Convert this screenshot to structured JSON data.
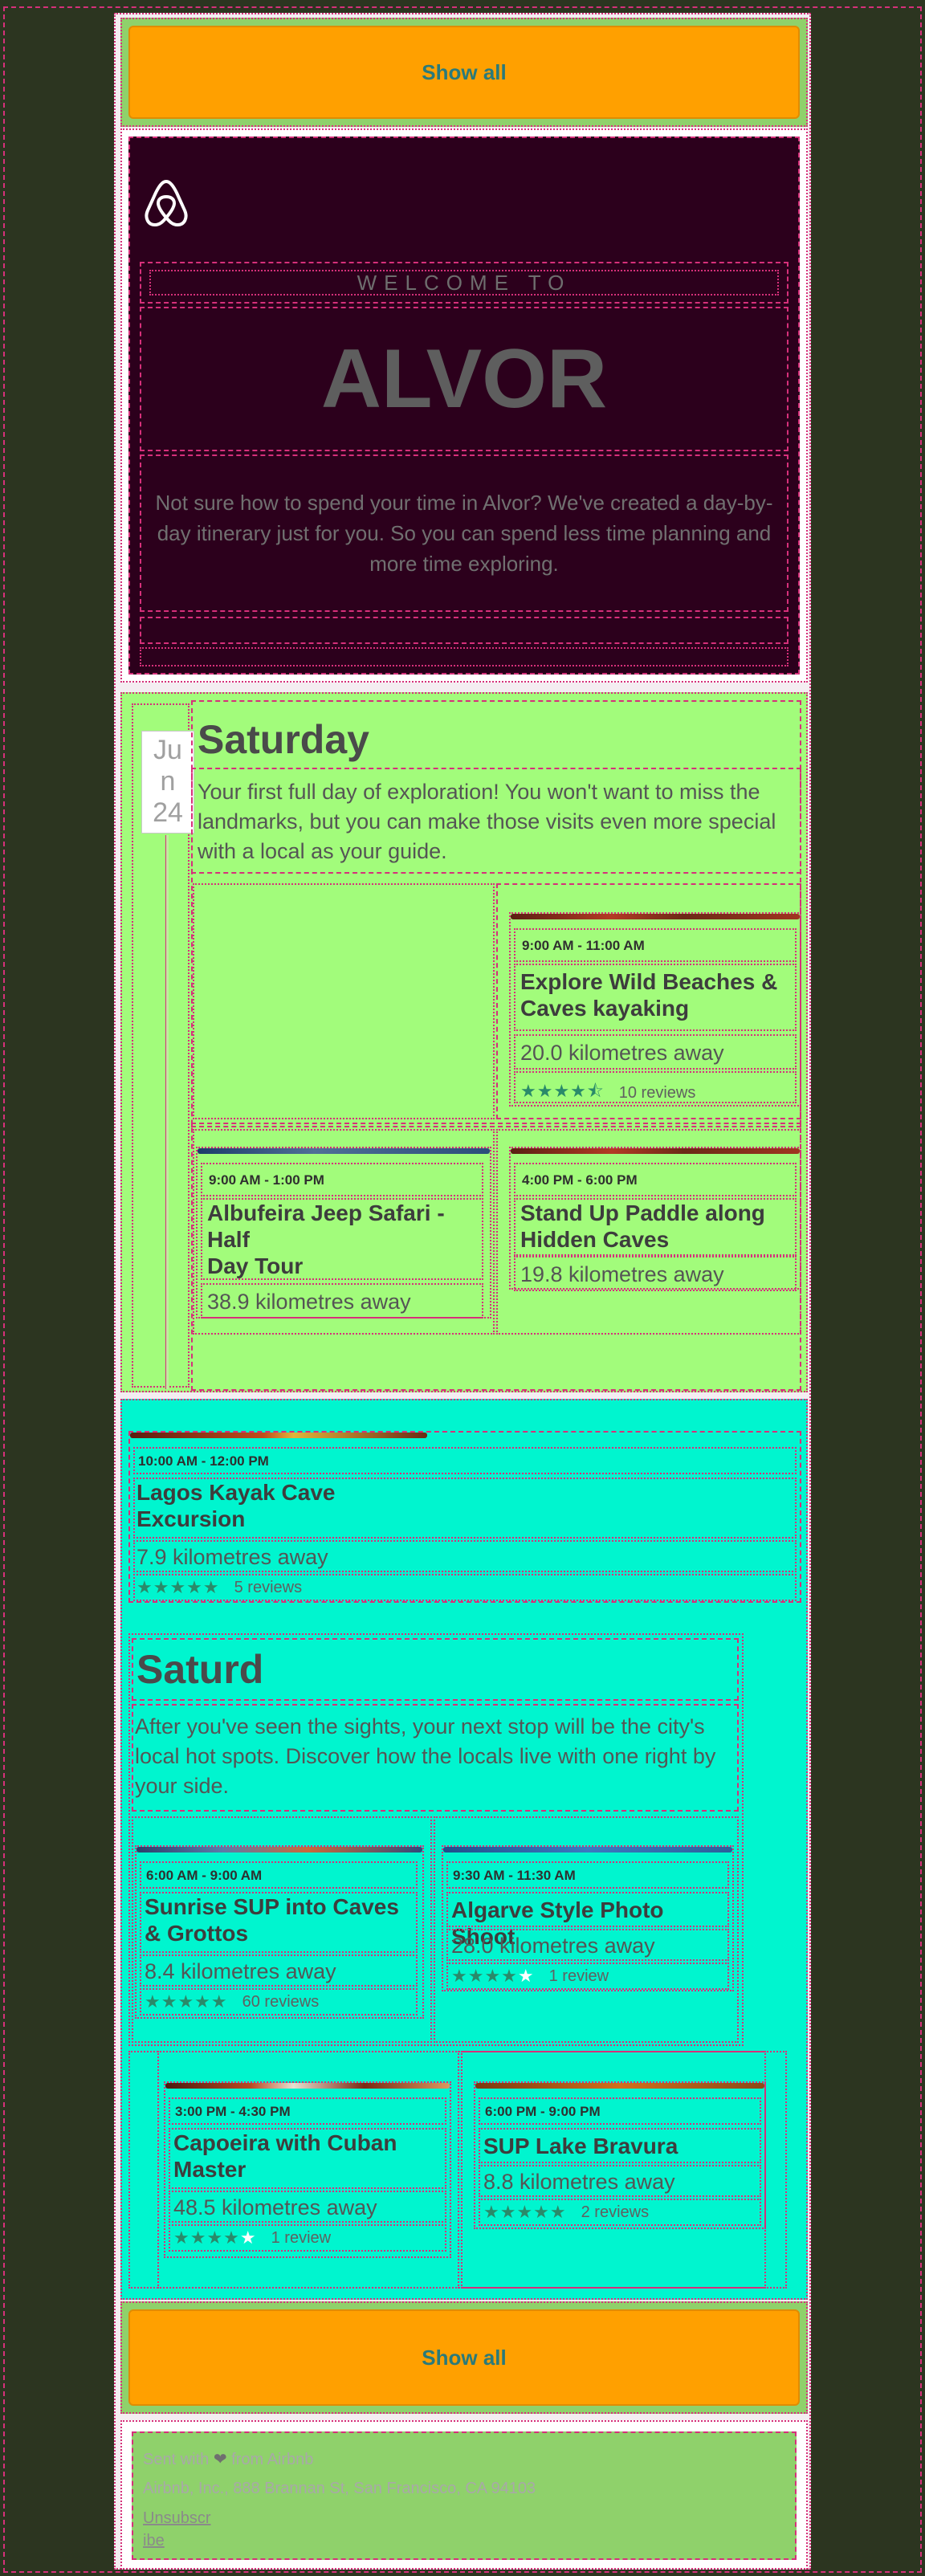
{
  "top_button": {
    "label": "Show all"
  },
  "hero": {
    "logo_icon": "airbnb-logo",
    "welcome": "WELCOME TO",
    "destination": "ALVOR",
    "intro": "Not sure how to spend your time in Alvor? We've created a day-by-day itinerary just for you. So you can spend less time planning and more time exploring."
  },
  "day1": {
    "date_lines": [
      "Ju",
      "n",
      "24"
    ],
    "title": "Saturday",
    "description": "Your first full day of exploration! You won't want to miss the landmarks, but you can make those visits even more special with a local as your guide.",
    "activities": [
      {
        "time": "9:00 AM - 11:00 AM",
        "name": "Explore Wild Beaches & Caves kayaking",
        "distance": "20.0 kilometres away",
        "rating": 4.5,
        "reviews": "10 reviews"
      },
      {
        "time": "9:00 AM - 1:00 PM",
        "name_lines": [
          "Albufeira Jeep Safari -",
          "Half",
          "Day Tour"
        ],
        "distance": "38.9 kilometres away"
      },
      {
        "time": "4:00 PM - 6:00 PM",
        "name": "Stand Up Paddle along Hidden Caves",
        "distance": "19.8 kilometres away"
      }
    ]
  },
  "day2": {
    "lead_activity": {
      "time": "10:00 AM - 12:00 PM",
      "name_lines": [
        "Lagos Kayak Cave",
        "Excursion"
      ],
      "distance": "7.9 kilometres away",
      "rating": 5,
      "reviews": "5 reviews"
    },
    "title": "Saturd",
    "description": "After you've seen the sights, your next stop will be the city's local hot spots. Discover how the locals live with one right by your side.",
    "activities": [
      {
        "time": "6:00 AM - 9:00 AM",
        "name": "Sunrise SUP into Caves & Grottos",
        "distance": "8.4 kilometres away",
        "rating": 5,
        "reviews": "60 reviews"
      },
      {
        "time": "9:30 AM - 11:30 AM",
        "name": "Algarve Style Photo Shoot",
        "distance": "28.0 kilometres away",
        "rating": 4,
        "reviews": "1 review"
      },
      {
        "time": "3:00 PM - 4:30 PM",
        "name": "Capoeira with Cuban Master",
        "distance": "48.5 kilometres away",
        "rating": 4,
        "reviews": "1 review"
      },
      {
        "time": "6:00 PM - 9:00 PM",
        "name": "SUP Lake Bravura",
        "distance": "8.8 kilometres away",
        "rating": 5,
        "reviews": "2 reviews"
      }
    ]
  },
  "bottom_button": {
    "label": "Show all"
  },
  "footer": {
    "sent_with": "Sent with",
    "heart_icon": "heart-icon",
    "from": "from Airbnb",
    "address": "Airbnb, Inc., 888 Brannan St, San Francisco, CA 94103",
    "unsubscribe_lines": [
      "Unsubscr",
      "ibe"
    ]
  },
  "colors": {
    "page_bg": "#2c3520",
    "hero_bg": "#2c001c",
    "day1_bg": "#a2fc7b",
    "day2_bg": "#00f5cf",
    "button_bg": "#ffa000",
    "footer_bg": "#8fd16b",
    "star": "#2a8a6a"
  }
}
